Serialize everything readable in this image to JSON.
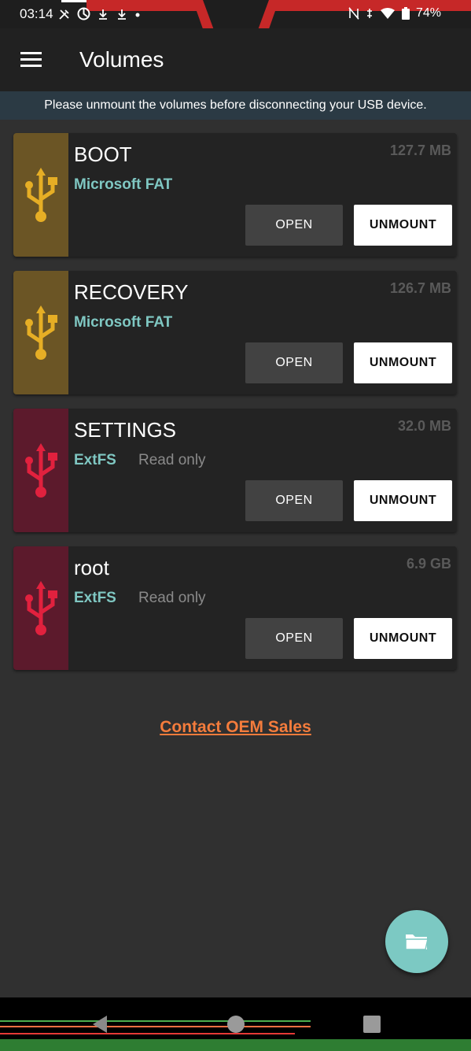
{
  "status_bar": {
    "time": "03:14",
    "battery": "74%",
    "icons_left": [
      "no-tools-icon",
      "sync-icon",
      "download-icon",
      "download-icon",
      "dot-icon"
    ],
    "icons_right": [
      "nfc-off-icon",
      "vibrate-icon",
      "wifi-icon",
      "battery-icon"
    ]
  },
  "app_bar": {
    "title": "Volumes"
  },
  "banner": {
    "text": "Please unmount the volumes before disconnecting your USB device."
  },
  "volumes": [
    {
      "name": "BOOT",
      "filesystem": "Microsoft FAT",
      "readonly_label": "",
      "size": "127.7 MB",
      "color": "#6b5525",
      "icon_color": "#e6ae25",
      "open_label": "OPEN",
      "unmount_label": "UNMOUNT"
    },
    {
      "name": "RECOVERY",
      "filesystem": "Microsoft FAT",
      "readonly_label": "",
      "size": "126.7 MB",
      "color": "#6b5525",
      "icon_color": "#e6ae25",
      "open_label": "OPEN",
      "unmount_label": "UNMOUNT"
    },
    {
      "name": "SETTINGS",
      "filesystem": "ExtFS",
      "readonly_label": "Read only",
      "size": "32.0 MB",
      "color": "#5c1a2c",
      "icon_color": "#e1213e",
      "open_label": "OPEN",
      "unmount_label": "UNMOUNT"
    },
    {
      "name": "root",
      "filesystem": "ExtFS",
      "readonly_label": "Read only",
      "size": "6.9 GB",
      "color": "#5c1a2c",
      "icon_color": "#e1213e",
      "open_label": "OPEN",
      "unmount_label": "UNMOUNT"
    }
  ],
  "contact": {
    "label": "Contact OEM Sales"
  },
  "fab": {
    "icon": "folder-open-icon"
  },
  "nav": {
    "back_icon": "back-triangle-icon",
    "home_icon": "home-circle-icon",
    "recents_icon": "recents-square-icon"
  },
  "colors": {
    "accent": "#7cc9c3",
    "filesystem_text": "#7fc7c2",
    "link": "#f47c3c",
    "background": "#303030",
    "app_bar": "#212121",
    "banner": "#2b3a44"
  }
}
